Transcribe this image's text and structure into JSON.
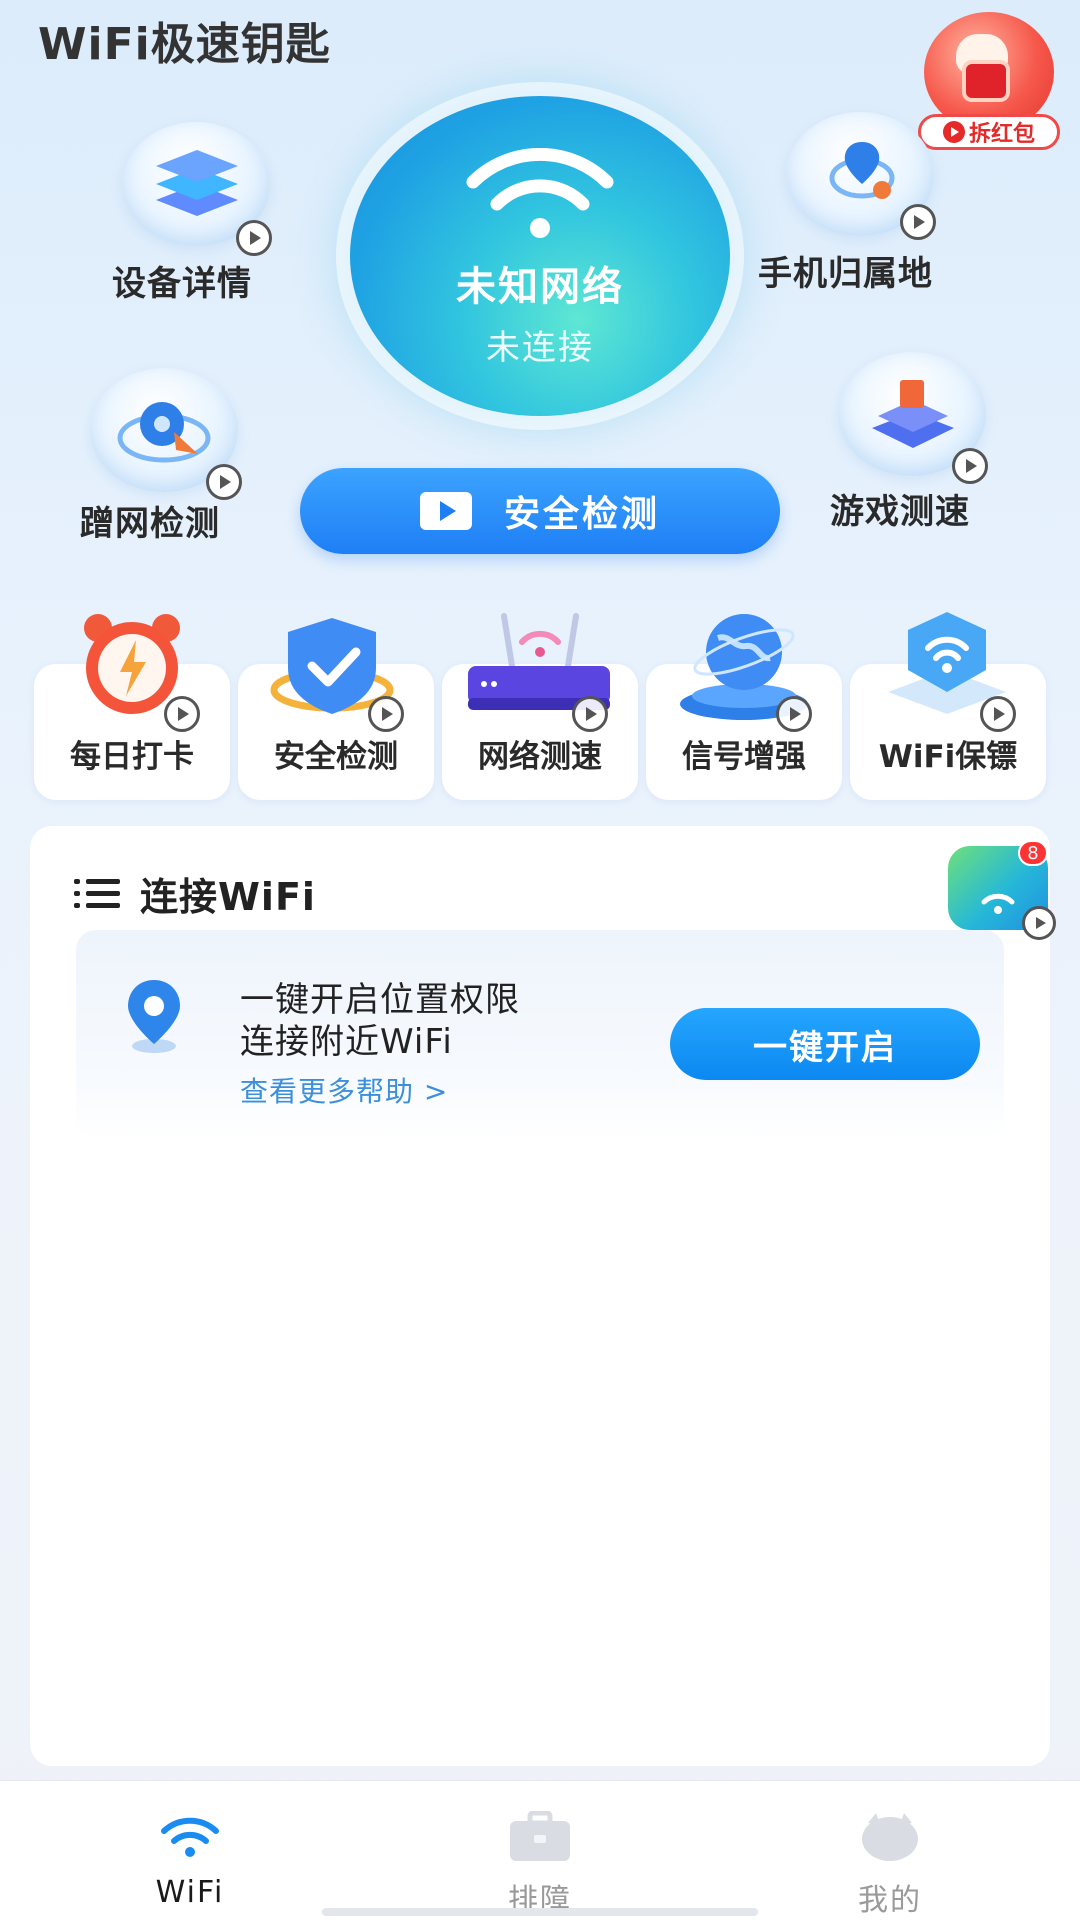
{
  "app": {
    "title": "WiFi极速钥匙"
  },
  "red_packet": {
    "label": "拆红包"
  },
  "network": {
    "name": "未知网络",
    "status": "未连接"
  },
  "orbs": [
    {
      "label": "设备详情",
      "icon": "layers-icon"
    },
    {
      "label": "手机归属地",
      "icon": "phone-location-icon"
    },
    {
      "label": "蹭网检测",
      "icon": "radar-icon"
    },
    {
      "label": "游戏测速",
      "icon": "cube-icon"
    }
  ],
  "security_button": {
    "label": "安全检测"
  },
  "features": [
    {
      "label": "每日打卡",
      "icon": "alarm-clock-icon"
    },
    {
      "label": "安全检测",
      "icon": "shield-icon"
    },
    {
      "label": "网络测速",
      "icon": "router-icon"
    },
    {
      "label": "信号增强",
      "icon": "globe-icon"
    },
    {
      "label": "WiFi保镖",
      "icon": "wifi-guard-icon"
    }
  ],
  "connect_section": {
    "title": "连接WiFi",
    "permission_line1": "一键开启位置权限",
    "permission_line2": "连接附近WiFi",
    "help_link": "查看更多帮助 >",
    "enable_button": "一键开启"
  },
  "float_widget": {
    "badge": "8"
  },
  "bottom_nav": [
    {
      "label": "WiFi",
      "icon": "wifi-icon",
      "active": true
    },
    {
      "label": "排障",
      "icon": "toolbox-icon",
      "active": false
    },
    {
      "label": "我的",
      "icon": "profile-icon",
      "active": false
    }
  ],
  "colors": {
    "primary": "#1e7ff5",
    "accent_red": "#e52a2a",
    "link": "#3c8fdc"
  }
}
